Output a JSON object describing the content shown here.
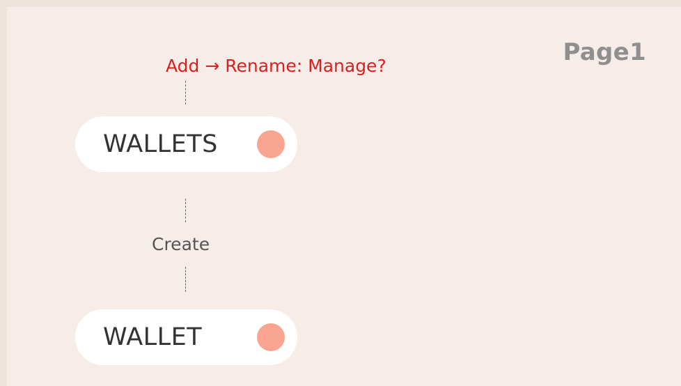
{
  "page": {
    "label": "Page1"
  },
  "annotation": {
    "text": "Add → Rename: Manage?",
    "color": "#dd1e1e"
  },
  "nodes": [
    {
      "label": "WALLETS",
      "dot_color": "#f9a591"
    },
    {
      "label": "WALLET",
      "dot_color": "#f9a591"
    }
  ],
  "edges": [
    {
      "label": "Create"
    }
  ],
  "colors": {
    "background": "#f6ede8",
    "outer_background": "#efe4dc",
    "node_fill": "#ffffff",
    "page_label": "#8f8f8f"
  }
}
